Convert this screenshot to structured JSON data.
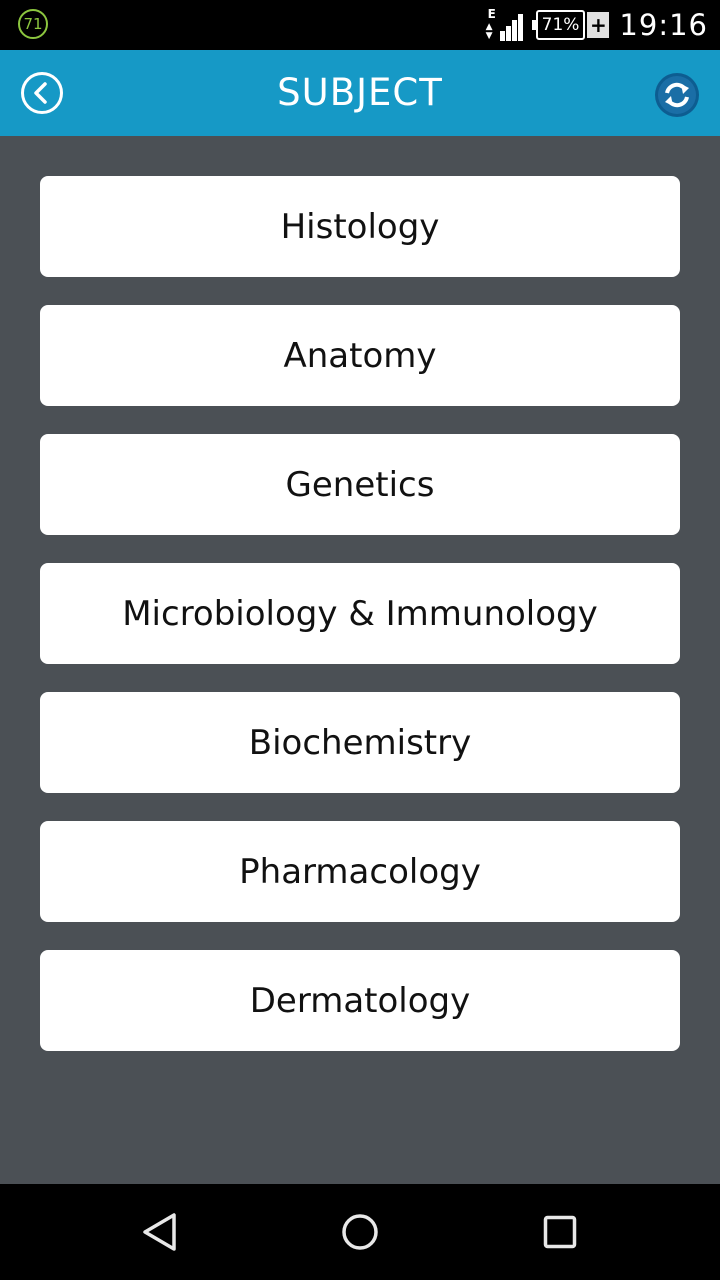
{
  "status_bar": {
    "notification_count": "71",
    "network_type": "E",
    "battery_percent": "71%",
    "battery_plus": "+",
    "time": "19:16"
  },
  "app_bar": {
    "title": "SUBJECT",
    "accent_color": "#1699c6",
    "back_icon": "back-circle-icon",
    "refresh_icon": "refresh-icon"
  },
  "subjects": [
    {
      "label": "Histology"
    },
    {
      "label": "Anatomy"
    },
    {
      "label": "Genetics"
    },
    {
      "label": "Microbiology & Immunology"
    },
    {
      "label": "Biochemistry"
    },
    {
      "label": "Pharmacology"
    },
    {
      "label": "Dermatology"
    }
  ],
  "nav_bar": {
    "back_icon": "nav-back-icon",
    "home_icon": "nav-home-icon",
    "recents_icon": "nav-recents-icon"
  }
}
